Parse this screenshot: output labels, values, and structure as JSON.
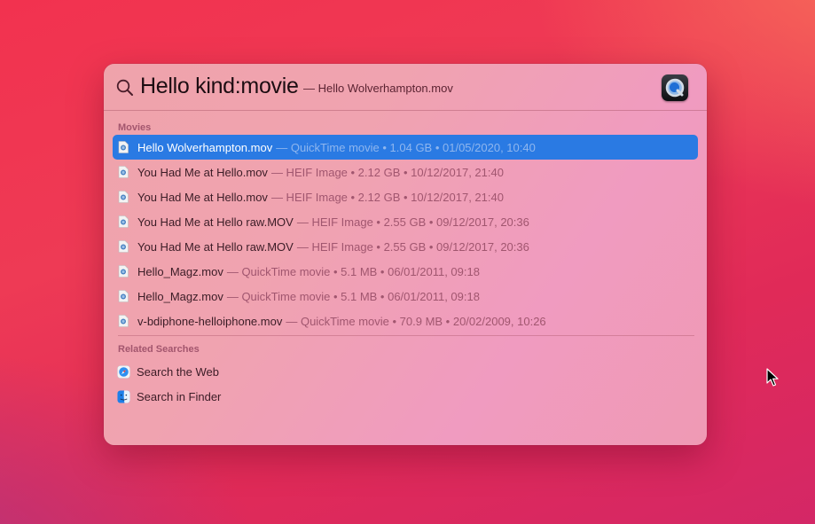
{
  "spotlight": {
    "query": "Hello kind:movie",
    "completion": "— Hello Wolverhampton.mov",
    "preview_app_icon": "quicktime-icon",
    "sections": {
      "movies_header": "Movies",
      "related_header": "Related Searches"
    },
    "results": [
      {
        "name": "Hello Wolverhampton.mov",
        "meta": "— QuickTime movie • 1.04 GB • 01/05/2020, 10:40",
        "selected": true
      },
      {
        "name": "You Had Me at Hello.mov",
        "meta": "— HEIF Image • 2.12 GB • 10/12/2017, 21:40"
      },
      {
        "name": "You Had Me at Hello.mov",
        "meta": "— HEIF Image • 2.12 GB • 10/12/2017, 21:40"
      },
      {
        "name": "You Had Me at Hello raw.MOV",
        "meta": "— HEIF Image • 2.55 GB • 09/12/2017, 20:36"
      },
      {
        "name": "You Had Me at Hello raw.MOV",
        "meta": "— HEIF Image • 2.55 GB • 09/12/2017, 20:36"
      },
      {
        "name": "Hello_Magz.mov",
        "meta": "— QuickTime movie • 5.1 MB • 06/01/2011, 09:18"
      },
      {
        "name": "Hello_Magz.mov",
        "meta": "— QuickTime movie • 5.1 MB • 06/01/2011, 09:18"
      },
      {
        "name": "v-bdiphone-helloiphone.mov",
        "meta": "— QuickTime movie • 70.9 MB • 20/02/2009, 10:26"
      }
    ],
    "related": [
      {
        "label": "Search the Web",
        "icon": "safari-icon"
      },
      {
        "label": "Search in Finder",
        "icon": "finder-icon"
      }
    ]
  },
  "colors": {
    "selection": "#2a7ae3",
    "section_header": "#a3566e"
  }
}
